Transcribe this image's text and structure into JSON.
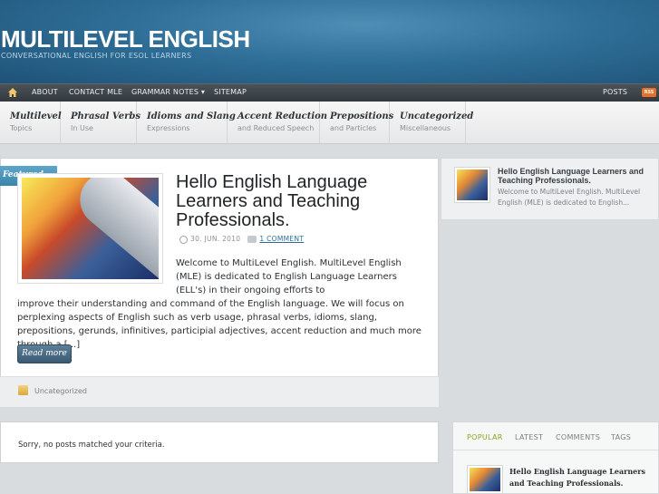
{
  "header": {
    "title": "MULTILEVEL ENGLISH",
    "tagline": "CONVERSATIONAL ENGLISH FOR ESOL LEARNERS"
  },
  "topnav": {
    "items": [
      "ABOUT",
      "CONTACT MLE",
      "GRAMMAR NOTES ▾",
      "SITEMAP"
    ],
    "posts_label": "POSTS",
    "rss_label": "RSS"
  },
  "categories": [
    {
      "title": "Multilevel",
      "sub": "Topics"
    },
    {
      "title": "Phrasal Verbs",
      "sub": "In Use"
    },
    {
      "title": "Idioms and Slang",
      "sub": "Expressions"
    },
    {
      "title": "Accent Reduction",
      "sub": "and Reduced Speech"
    },
    {
      "title": "Prepositions",
      "sub": "and Particles"
    },
    {
      "title": "Uncategorized",
      "sub": "Miscellaneous"
    }
  ],
  "featured_post": {
    "badge": "Featured",
    "title": "Hello English Language Learners and Teaching Professionals.",
    "date": "30. JUN. 2010",
    "comments": "1 COMMENT",
    "excerpt_top": "Welcome to MultiLevel English. MultiLevel English (MLE) is dedicated to English Language Learners (ELL's) in their ongoing efforts to",
    "excerpt_bottom": "improve their understanding and command of the English language.  We will focus on perplexing aspects of English such as verb usage, phrasal verbs, idioms, slang, prepositions, gerunds, infinitives, participial adjectives, accent reduction and much more through a [...]",
    "read_more": "Read more",
    "category": "Uncategorized"
  },
  "sidebar_post": {
    "title": "Hello English Language Learners and Teaching Professionals.",
    "excerpt": "Welcome to MultiLevel English. MultiLevel English (MLE) is dedicated to English..."
  },
  "no_posts_message": "Sorry, no posts matched your criteria.",
  "tabs": {
    "items": [
      "POPULAR",
      "LATEST",
      "COMMENTS",
      "TAGS"
    ],
    "active": "POPULAR",
    "popular_title": "Hello English Language Learners and Teaching Professionals."
  },
  "colors": {
    "header_blue": "#2f6f98",
    "nav_dark": "#3a4146",
    "accent_green": "#8da324",
    "link_blue": "#2c6f96"
  }
}
